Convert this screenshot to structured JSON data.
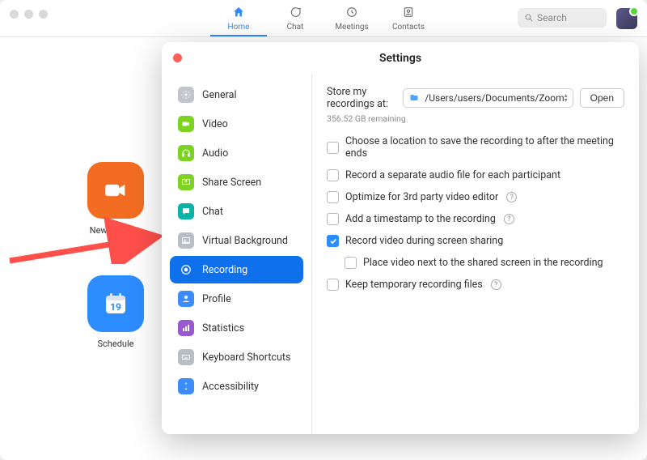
{
  "nav": {
    "home": "Home",
    "chat": "Chat",
    "meetings": "Meetings",
    "contacts": "Contacts",
    "search_placeholder": "Search"
  },
  "tiles": {
    "new_meeting": "New Meeting",
    "schedule": "Schedule",
    "schedule_day": "19"
  },
  "settings": {
    "title": "Settings",
    "store_label": "Store my recordings at:",
    "path": "/Users/users/Documents/Zoom",
    "open": "Open",
    "remaining": "356.52 GB remaining",
    "opt_choose_location": "Choose a location to save the recording to after the meeting ends",
    "opt_separate_audio": "Record a separate audio file for each participant",
    "opt_optimize": "Optimize for 3rd party video editor",
    "opt_timestamp": "Add a timestamp to the recording",
    "opt_record_share": "Record video during screen sharing",
    "opt_place_video": "Place video next to the shared screen in the recording",
    "opt_keep_temp": "Keep temporary recording files"
  },
  "sidebar": {
    "items": [
      {
        "label": "General"
      },
      {
        "label": "Video"
      },
      {
        "label": "Audio"
      },
      {
        "label": "Share Screen"
      },
      {
        "label": "Chat"
      },
      {
        "label": "Virtual Background"
      },
      {
        "label": "Recording"
      },
      {
        "label": "Profile"
      },
      {
        "label": "Statistics"
      },
      {
        "label": "Keyboard Shortcuts"
      },
      {
        "label": "Accessibility"
      }
    ]
  }
}
